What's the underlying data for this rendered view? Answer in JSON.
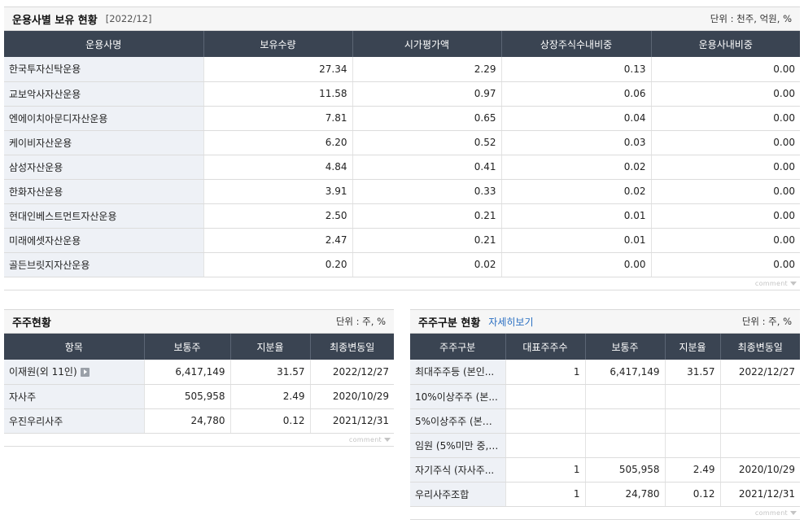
{
  "holdings": {
    "title": "운용사별 보유 현황",
    "date": "[2022/12]",
    "unit": "단위 : 천주, 억원, %",
    "columns": [
      "운용사명",
      "보유수량",
      "시가평가액",
      "상장주식수내비중",
      "운용사내비중"
    ],
    "rows": [
      [
        "한국투자신탁운용",
        "27.34",
        "2.29",
        "0.13",
        "0.00"
      ],
      [
        "교보악사자산운용",
        "11.58",
        "0.97",
        "0.06",
        "0.00"
      ],
      [
        "엔에이치아문디자산운용",
        "7.81",
        "0.65",
        "0.04",
        "0.00"
      ],
      [
        "케이비자산운용",
        "6.20",
        "0.52",
        "0.03",
        "0.00"
      ],
      [
        "삼성자산운용",
        "4.84",
        "0.41",
        "0.02",
        "0.00"
      ],
      [
        "한화자산운용",
        "3.91",
        "0.33",
        "0.02",
        "0.00"
      ],
      [
        "현대인베스트먼트자산운용",
        "2.50",
        "0.21",
        "0.01",
        "0.00"
      ],
      [
        "미래에셋자산운용",
        "2.47",
        "0.21",
        "0.01",
        "0.00"
      ],
      [
        "골든브릿지자산운용",
        "0.20",
        "0.02",
        "0.00",
        "0.00"
      ]
    ],
    "comment": "comment"
  },
  "shareholders": {
    "title": "주주현황",
    "unit": "단위 : 주, %",
    "columns": [
      "항목",
      "보통주",
      "지분율",
      "최종변동일"
    ],
    "rows": [
      [
        "이재원(외 11인)",
        "6,417,149",
        "31.57",
        "2022/12/27"
      ],
      [
        "자사주",
        "505,958",
        "2.49",
        "2020/10/29"
      ],
      [
        "우진우리사주",
        "24,780",
        "0.12",
        "2021/12/31"
      ]
    ],
    "comment": "comment"
  },
  "classification": {
    "title": "주주구분 현황",
    "link": "자세히보기",
    "unit": "단위 : 주, %",
    "columns": [
      "주주구분",
      "대표주주수",
      "보통주",
      "지분율",
      "최종변동일"
    ],
    "rows": [
      [
        "최대주주등 (본인...",
        "1",
        "6,417,149",
        "31.57",
        "2022/12/27"
      ],
      [
        "10%이상주주 (본...",
        "",
        "",
        "",
        ""
      ],
      [
        "5%이상주주 (본인...",
        "",
        "",
        "",
        ""
      ],
      [
        "임원 (5%미만 중, ...",
        "",
        "",
        "",
        ""
      ],
      [
        "자기주식 (자사주...",
        "1",
        "505,958",
        "2.49",
        "2020/10/29"
      ],
      [
        "우리사주조합",
        "1",
        "24,780",
        "0.12",
        "2021/12/31"
      ]
    ],
    "comment": "comment"
  }
}
